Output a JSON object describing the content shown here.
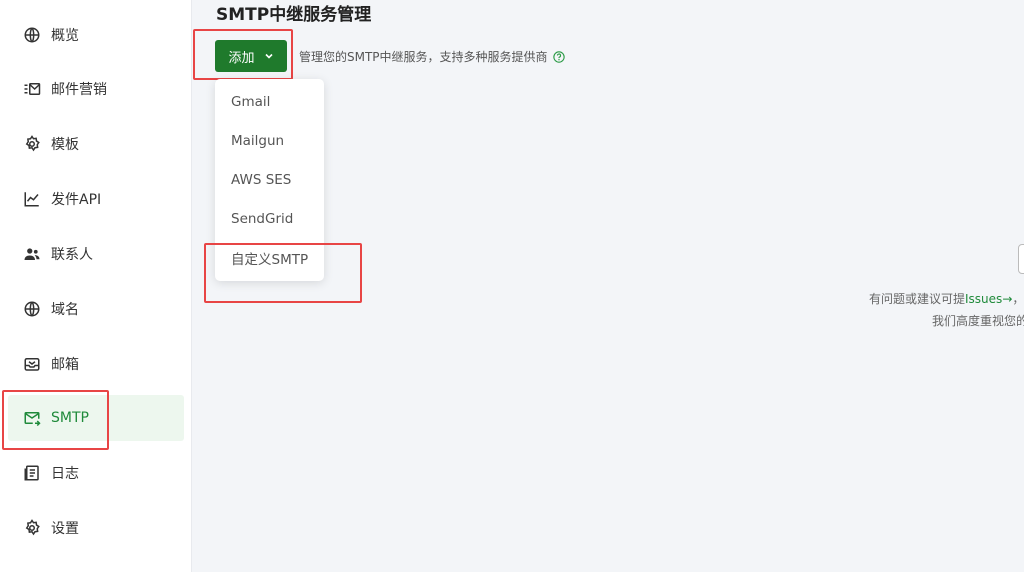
{
  "sidebar": {
    "items": [
      {
        "label": "概览",
        "icon": "globe-icon"
      },
      {
        "label": "邮件营销",
        "icon": "mail-list-icon"
      },
      {
        "label": "模板",
        "icon": "gear-icon"
      },
      {
        "label": "发件API",
        "icon": "chart-line-icon"
      },
      {
        "label": "联系人",
        "icon": "users-icon"
      },
      {
        "label": "域名",
        "icon": "globe-icon"
      },
      {
        "label": "邮箱",
        "icon": "inbox-icon"
      },
      {
        "label": "SMTP",
        "icon": "mail-forward-icon",
        "active": true
      },
      {
        "label": "日志",
        "icon": "log-icon"
      },
      {
        "label": "设置",
        "icon": "gear-icon"
      }
    ]
  },
  "main": {
    "title": "SMTP中继服务管理",
    "add_button": "添加",
    "subtitle": "管理您的SMTP中继服务，支持多种服务提供商",
    "dropdown": [
      "Gmail",
      "Mailgun",
      "AWS SES",
      "SendGrid",
      "自定义SMTP"
    ],
    "feedback_prefix": "有问题或建议可提",
    "feedback_link": "Issues",
    "feedback_arrow": "→",
    "feedback_suffix": "，",
    "feedback_line2": "我们高度重视您的"
  },
  "colors": {
    "accent": "#1f7a2c",
    "active_bg": "#edf7ee",
    "highlight": "#e84545"
  }
}
